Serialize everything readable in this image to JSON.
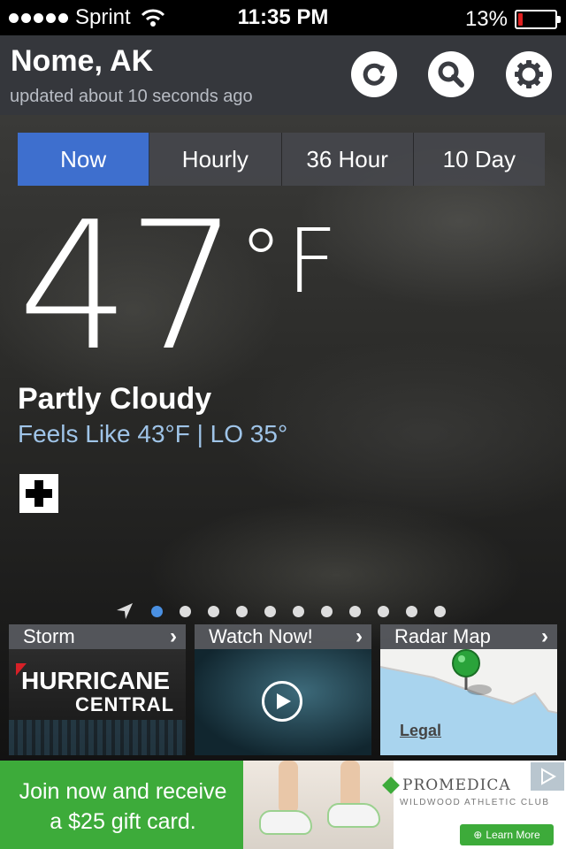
{
  "status_bar": {
    "carrier": "Sprint",
    "time": "11:35 PM",
    "battery_percent": "13%",
    "battery_level": 0.13,
    "battery_color": "#e02020"
  },
  "header": {
    "city": "Nome, AK",
    "updated": "updated about 10 seconds ago",
    "icons": [
      "refresh-icon",
      "search-icon",
      "gear-icon"
    ]
  },
  "tabs": [
    {
      "label": "Now",
      "active": true
    },
    {
      "label": "Hourly",
      "active": false
    },
    {
      "label": "36 Hour",
      "active": false
    },
    {
      "label": "10 Day",
      "active": false
    }
  ],
  "current": {
    "temperature": "47",
    "unit": "°F",
    "condition": "Partly Cloudy",
    "feels_like": "Feels Like 43°F |  LO 35°"
  },
  "pager": {
    "page_count": 11,
    "active_index": 0
  },
  "cards": [
    {
      "title": "Storm",
      "image_text_1": "HURRICANE",
      "image_text_2": "CENTRAL"
    },
    {
      "title": "Watch Now!"
    },
    {
      "title": "Radar Map",
      "legal": "Legal"
    }
  ],
  "ad": {
    "line1": "Join now and receive",
    "line2": "a $25 gift card.",
    "brand": "PROMEDICA",
    "brand_sub": "WILDWOOD ATHLETIC CLUB",
    "cta": "Learn More"
  },
  "colors": {
    "accent_tab": "#3e6fce",
    "feels_text": "#9fc4e8",
    "ad_green": "#3dab3a"
  }
}
